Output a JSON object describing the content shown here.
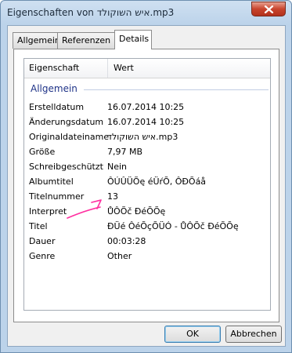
{
  "window": {
    "title": "Eigenschaften von איש השוקולד.mp3"
  },
  "tabs": [
    {
      "label": "Allgemein"
    },
    {
      "label": "Referenzen"
    },
    {
      "label": "Details"
    }
  ],
  "details": {
    "header": {
      "property": "Eigenschaft",
      "value": "Wert"
    },
    "group": "Allgemein",
    "rows": [
      {
        "name": "Erstelldatum",
        "value": "16.07.2014 10:25"
      },
      {
        "name": "Änderungsdatum",
        "value": "16.07.2014 10:25"
      },
      {
        "name": "Originaldateiname",
        "value": "איש השוקולד.mp3"
      },
      {
        "name": "Größe",
        "value": "7,97 MB"
      },
      {
        "name": "Schreibgeschützt",
        "value": "Nein"
      },
      {
        "name": "Albumtitel",
        "value": "ÔÚÛÜÕę éÜŕÕ, ÔĐÕáå"
      },
      {
        "name": "Titelnummer",
        "value": "13"
      },
      {
        "name": "Interpret",
        "value": "ŮÔÕč ĐéÕÕę"
      },
      {
        "name": "Titel",
        "value": "ĐÜé ÔéÕçÕÜÓ - ŮÔÕč ĐéÕÕę"
      },
      {
        "name": "Dauer",
        "value": "00:03:28"
      },
      {
        "name": "Genre",
        "value": "Other"
      }
    ]
  },
  "buttons": {
    "ok": "OK",
    "cancel": "Abbrechen"
  },
  "colors": {
    "group_heading": "#1e3287",
    "annotation": "#ff2fa0"
  }
}
